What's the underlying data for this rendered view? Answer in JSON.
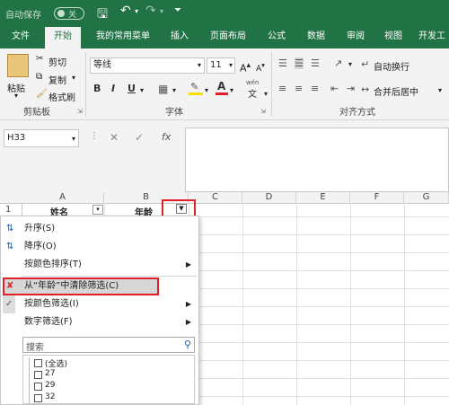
{
  "titlebar": {
    "autosave_label": "自动保存",
    "autosave_state": "关"
  },
  "tabs": [
    "文件",
    "开始",
    "我的常用菜单",
    "插入",
    "页面布局",
    "公式",
    "数据",
    "审阅",
    "视图",
    "开发工"
  ],
  "ribbon": {
    "clipboard": {
      "paste": "粘贴",
      "cut": "剪切",
      "copy": "复制",
      "format_painter": "格式刷",
      "group": "剪贴板"
    },
    "font": {
      "name": "等线",
      "size": "11",
      "bold": "B",
      "italic": "I",
      "underline": "U",
      "group": "字体",
      "pinyin": "wén"
    },
    "align": {
      "wrap": "自动换行",
      "merge": "合并后居中",
      "group": "对齐方式"
    }
  },
  "formula": {
    "namebox": "H33",
    "fx": "fx"
  },
  "grid": {
    "columns": [
      "A",
      "B",
      "C",
      "D",
      "E",
      "F",
      "G"
    ],
    "row1_num": "1",
    "a1": "姓名",
    "b1": "年龄"
  },
  "menu": {
    "sort_asc": "升序(S)",
    "sort_desc": "降序(O)",
    "sort_color": "按颜色排序(T)",
    "clear_filter": "从“年龄”中清除筛选(C)",
    "filter_color": "按颜色筛选(I)",
    "number_filter": "数字筛选(F)",
    "search_placeholder": "搜索",
    "items": [
      "(全选)",
      "27",
      "29",
      "32"
    ]
  },
  "colors": {
    "accent": "#217346",
    "highlight_border": "#e0202a"
  }
}
